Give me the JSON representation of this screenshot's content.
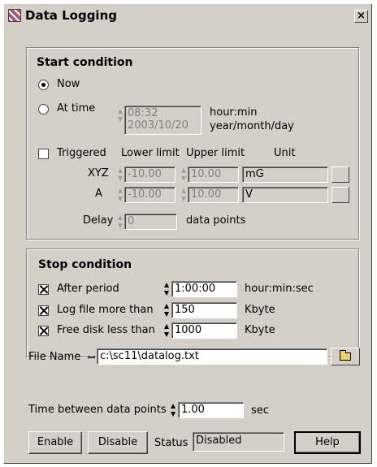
{
  "window": {
    "title": "Data Logging",
    "close_label": "×"
  },
  "start": {
    "title": "Start condition",
    "now_label": "Now",
    "attime_label": "At time",
    "time_value": "08:32",
    "date_value": "2003/10/20",
    "time_unit": "hour:min",
    "date_unit": "year/month/day",
    "triggered_label": "Triggered",
    "lower_header": "Lower limit",
    "upper_header": "Upper limit",
    "unit_header": "Unit",
    "rows": [
      {
        "label": "XYZ",
        "lower": "-10.00",
        "upper": "10.00",
        "unit": "mG"
      },
      {
        "label": "A",
        "lower": "-10.00",
        "upper": "10.00",
        "unit": "V"
      }
    ],
    "delay_label": "Delay",
    "delay_value": "0",
    "delay_unit": "data points",
    "now_selected": true,
    "triggered_checked": false
  },
  "stop": {
    "title": "Stop condition",
    "after_label": "After period",
    "after_value": "1:00:00",
    "after_unit": "hour:min:sec",
    "logfile_label": "Log file more than",
    "logfile_value": "150",
    "logfile_unit": "Kbyte",
    "disk_label": "Free disk less than",
    "disk_value": "1000",
    "disk_unit": "Kbyte"
  },
  "file": {
    "label": "File Name",
    "value": "c:\\sc11\\datalog.txt"
  },
  "interval": {
    "label": "Time between data points",
    "value": "1.00",
    "unit": "sec"
  },
  "footer": {
    "enable_label": "Enable",
    "disable_label": "Disable",
    "status_label": "Status",
    "status_value": "Disabled",
    "help_label": "Help"
  }
}
